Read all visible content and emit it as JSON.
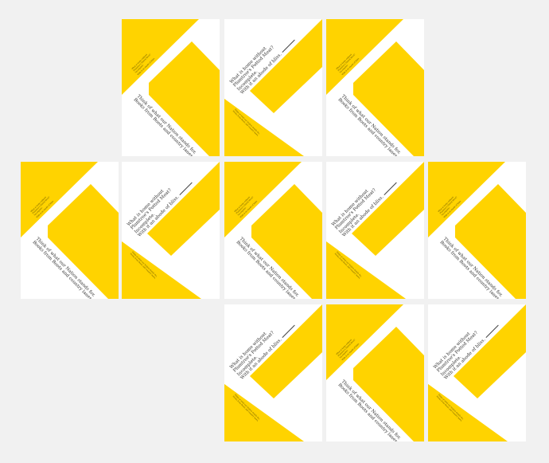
{
  "colors": {
    "background": "#f1f1f1",
    "card": "#ffffff",
    "accent": "#ffd300",
    "text": "#333333"
  },
  "verse_a": {
    "lines": [
      "Think of what our Nation stands for,",
      "Books from Boots and country lanes,"
    ]
  },
  "verse_b": {
    "lines": [
      "What is home without",
      "Plumtree's Potted Meat?",
      "Incomplete.",
      "With it an abode of bliss."
    ]
  },
  "tiles": [
    {
      "variant": "a"
    },
    {
      "variant": "b"
    },
    {
      "variant": "a"
    },
    {
      "variant": "a"
    },
    {
      "variant": "b"
    },
    {
      "variant": "a"
    },
    {
      "variant": "b"
    },
    {
      "variant": "a"
    },
    {
      "variant": "b"
    },
    {
      "variant": "a"
    },
    {
      "variant": "b"
    }
  ]
}
